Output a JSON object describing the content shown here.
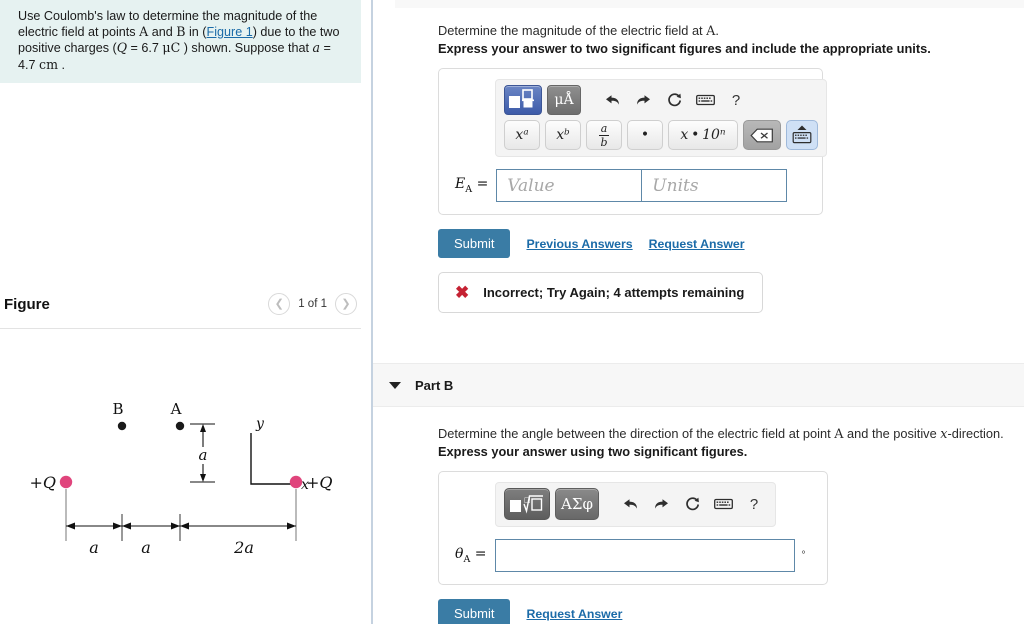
{
  "left": {
    "question": {
      "segments": [
        {
          "t": "Use Coulomb's law to determine the magnitude of the electric field at points ",
          "s": "plain"
        },
        {
          "t": "A",
          "s": "serif"
        },
        {
          "t": " and ",
          "s": "plain"
        },
        {
          "t": "B",
          "s": "serif"
        },
        {
          "t": " in (",
          "s": "plain"
        },
        {
          "t": "Figure 1",
          "s": "link"
        },
        {
          "t": ") due to the two positive charges (",
          "s": "plain"
        },
        {
          "t": "Q",
          "s": "ital"
        },
        {
          "t": " = 6.7 ",
          "s": "plain"
        },
        {
          "t": "μC",
          "s": "serif"
        },
        {
          "t": " ) shown. Suppose that ",
          "s": "plain"
        },
        {
          "t": "a",
          "s": "ital"
        },
        {
          "t": " = 4.7 ",
          "s": "plain"
        },
        {
          "t": "cm",
          "s": "serif"
        },
        {
          "t": " .",
          "s": "plain"
        }
      ],
      "figure_link_label": "Figure 1",
      "charge_value": "6.7",
      "charge_unit": "μC",
      "a_value": "4.7",
      "a_unit": "cm"
    },
    "figure": {
      "title": "Figure",
      "counter": "1 of 1",
      "prev_icon": "chevron-left-icon",
      "next_icon": "chevron-right-icon",
      "labels": {
        "pointB": "B",
        "pointA": "A",
        "axis_y": "y",
        "axis_x": "x",
        "vertical_gap": "a",
        "charge_left": "+Q",
        "charge_right": "+Q",
        "dim1": "a",
        "dim2": "a",
        "dim3": "2a"
      },
      "charge_color": "#e0447c",
      "point_color": "#1a1a1a"
    }
  },
  "right": {
    "partA": {
      "prompt_pre": "Determine the magnitude of the electric field at ",
      "prompt_var": "A",
      "prompt_post": ".",
      "instruction": "Express your answer to two significant figures and include the appropriate units.",
      "toolbar": {
        "template_button": "math-template-icon",
        "units_button": "μÅ",
        "undo_icon": "undo-icon",
        "redo_icon": "redo-icon",
        "reset_icon": "reset-icon",
        "keyboard_icon": "keyboard-icon",
        "help_label": "?",
        "keys": [
          {
            "id": "superscript",
            "label": "xᵃ"
          },
          {
            "id": "subscript",
            "label": "xᵇ"
          },
          {
            "id": "fraction",
            "num": "a",
            "den": "b"
          },
          {
            "id": "dot",
            "label": "•"
          },
          {
            "id": "scientific",
            "label": "x • 10ⁿ"
          },
          {
            "id": "backspace",
            "label": "backspace-icon"
          },
          {
            "id": "keyboard-up",
            "label": "keyboard-up-icon"
          }
        ]
      },
      "field_label": "E",
      "field_sub": "A",
      "equals": "=",
      "value_placeholder": "Value",
      "units_placeholder": "Units",
      "value_text": "",
      "units_text": "",
      "submit_label": "Submit",
      "previous_answers_label": "Previous Answers",
      "request_answer_label": "Request Answer",
      "feedback": {
        "icon": "x-cross-icon",
        "text": "Incorrect; Try Again; 4 attempts remaining",
        "icon_color": "#c52233"
      }
    },
    "partB": {
      "header_title": "Part B",
      "caret_icon": "caret-down-icon",
      "prompt_pre": "Determine the angle between the direction of the electric field at point ",
      "prompt_var": "A",
      "prompt_mid": " and the positive ",
      "prompt_var2": "x",
      "prompt_post": "-direction.",
      "instruction": "Express your answer using two significant figures.",
      "toolbar": {
        "template_button": "sqrt-template-icon",
        "greek_button": "ΑΣφ",
        "undo_icon": "undo-icon",
        "redo_icon": "redo-icon",
        "reset_icon": "reset-icon",
        "keyboard_icon": "keyboard-icon",
        "help_label": "?"
      },
      "field_label": "θ",
      "field_sub": "A",
      "equals": "=",
      "answer_text": "",
      "degree_symbol": "°",
      "submit_label": "Submit",
      "request_answer_label": "Request Answer"
    }
  },
  "colors": {
    "accent": "#3a7ca5",
    "link": "#1b6ba8",
    "question_bg": "#e6f2f1",
    "error": "#c52233",
    "charge_pink": "#e0447c"
  }
}
